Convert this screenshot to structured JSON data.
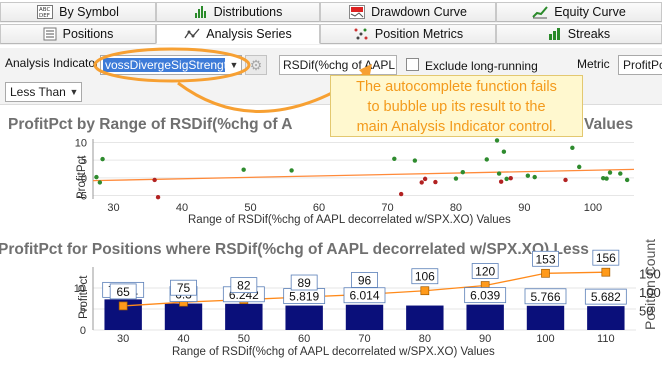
{
  "tabs_row1": [
    {
      "label": "By Symbol",
      "icon": "abc-def-icon"
    },
    {
      "label": "Distributions",
      "icon": "histogram-icon"
    },
    {
      "label": "Drawdown Curve",
      "icon": "drawdown-icon"
    },
    {
      "label": "Equity Curve",
      "icon": "equity-curve-icon"
    }
  ],
  "tabs_row2": [
    {
      "label": "Positions",
      "icon": "list-icon",
      "active": false
    },
    {
      "label": "Analysis Series",
      "icon": "analysis-icon",
      "active": true
    },
    {
      "label": "Position Metrics",
      "icon": "metrics-icon",
      "active": false
    },
    {
      "label": "Streaks",
      "icon": "streaks-icon",
      "active": false
    }
  ],
  "toolbar": {
    "indicator_label": "Analysis Indicator",
    "indicator_value": "vossDivergeSigStrengt",
    "rsdif_text": "RSDif(%chg of AAPL...",
    "exclude_label": "Exclude long-running",
    "metric_label": "Metric",
    "metric_value": "ProfitPc",
    "compare_value": "Less Than"
  },
  "callout_lines": [
    "The autocomplete function fails",
    "to bubble up its result to the",
    "main Analysis Indicator control."
  ],
  "chart1": {
    "title_left": "ProfitPct by Range of RSDif(%chg of A",
    "title_right": "Values",
    "ylabel": "ProfitPct",
    "xlabel": "Range of RSDif(%chg of AAPL decorrelated w/SPX.XO) Values"
  },
  "chart2": {
    "title": "ProfitPct for Positions where RSDif(%chg of AAPL decorrelated w/SPX.XO) Less",
    "ylabel": "ProfitPct",
    "y2label": "Position Count",
    "xlabel": "Range of RSDif(%chg of AAPL decorrelated w/SPX.XO) Values"
  },
  "chart_data": [
    {
      "type": "scatter",
      "title": "ProfitPct by Range of RSDif(%chg of AAPL decorrelated w/SPX.XO) Values",
      "xlabel": "Range of RSDif(%chg of AAPL decorrelated w/SPX.XO) Values",
      "ylabel": "ProfitPct",
      "xlim": [
        27,
        106
      ],
      "ylim": [
        -6,
        11
      ],
      "xticks": [
        30,
        40,
        50,
        60,
        70,
        80,
        90,
        100
      ],
      "yticks": [
        -5,
        0,
        5,
        10
      ],
      "points": [
        {
          "x": 27.5,
          "y": 0.2,
          "color": "#2e8b2e"
        },
        {
          "x": 28,
          "y": -1.3,
          "color": "#2e8b2e"
        },
        {
          "x": 28.4,
          "y": 5.3,
          "color": "#2e8b2e"
        },
        {
          "x": 36,
          "y": -0.6,
          "color": "#b22222"
        },
        {
          "x": 36.5,
          "y": -5.5,
          "color": "#b22222"
        },
        {
          "x": 49,
          "y": 2.3,
          "color": "#2e8b2e"
        },
        {
          "x": 56,
          "y": 2.1,
          "color": "#2e8b2e"
        },
        {
          "x": 71,
          "y": 5.4,
          "color": "#2e8b2e"
        },
        {
          "x": 72,
          "y": -4.6,
          "color": "#b22222"
        },
        {
          "x": 74,
          "y": 4.9,
          "color": "#2e8b2e"
        },
        {
          "x": 75,
          "y": -1.3,
          "color": "#b22222"
        },
        {
          "x": 75.5,
          "y": -0.3,
          "color": "#b22222"
        },
        {
          "x": 77,
          "y": -1.2,
          "color": "#b22222"
        },
        {
          "x": 80,
          "y": -0.2,
          "color": "#2e8b2e"
        },
        {
          "x": 81,
          "y": 1.6,
          "color": "#2e8b2e"
        },
        {
          "x": 84.5,
          "y": 5.2,
          "color": "#2e8b2e"
        },
        {
          "x": 86,
          "y": 10.6,
          "color": "#2e8b2e"
        },
        {
          "x": 86.3,
          "y": 1.2,
          "color": "#2e8b2e"
        },
        {
          "x": 86.6,
          "y": -1.1,
          "color": "#b22222"
        },
        {
          "x": 87,
          "y": 7.4,
          "color": "#2e8b2e"
        },
        {
          "x": 87.4,
          "y": -0.3,
          "color": "#2e8b2e"
        },
        {
          "x": 88,
          "y": -0.1,
          "color": "#b22222"
        },
        {
          "x": 90.5,
          "y": 0.6,
          "color": "#2e8b2e"
        },
        {
          "x": 91.5,
          "y": 0.2,
          "color": "#2e8b2e"
        },
        {
          "x": 96,
          "y": -0.6,
          "color": "#b22222"
        },
        {
          "x": 97,
          "y": 8.5,
          "color": "#2e8b2e"
        },
        {
          "x": 98,
          "y": 3.1,
          "color": "#2e8b2e"
        },
        {
          "x": 101.5,
          "y": -0.1,
          "color": "#2e8b2e"
        },
        {
          "x": 102,
          "y": -0.2,
          "color": "#2e8b2e"
        },
        {
          "x": 102.5,
          "y": 1.5,
          "color": "#2e8b2e"
        },
        {
          "x": 104,
          "y": 1.2,
          "color": "#2e8b2e"
        },
        {
          "x": 105,
          "y": -0.6,
          "color": "#2e8b2e"
        }
      ],
      "trend": {
        "x": [
          27,
          106
        ],
        "y": [
          -0.8,
          2.4
        ]
      }
    },
    {
      "type": "bar",
      "title": "ProfitPct for Positions where RSDif(%chg of AAPL decorrelated w/SPX.XO) Less",
      "xlabel": "Range of RSDif(%chg of AAPL decorrelated w/SPX.XO) Values",
      "ylabel": "ProfitPct",
      "y2label": "Position Count",
      "categories": [
        30,
        40,
        50,
        60,
        70,
        80,
        90,
        100,
        110
      ],
      "ylim": [
        0,
        15
      ],
      "yticks": [
        0,
        5,
        10
      ],
      "y2lim": [
        0,
        170
      ],
      "y2ticks": [
        50,
        100,
        150
      ],
      "series": [
        {
          "name": "ProfitPct",
          "values": [
            7.291,
            6.3,
            6.242,
            5.819,
            6.014,
            5.823,
            6.039,
            5.766,
            5.682
          ],
          "labels": [
            "7.291",
            "6.3",
            "6.242",
            "5.819",
            "6.014",
            "",
            "6.039",
            "5.766",
            "5.682"
          ]
        },
        {
          "name": "Position Count",
          "values": [
            65,
            75,
            82,
            89,
            96,
            106,
            120,
            153,
            156
          ]
        }
      ]
    }
  ]
}
